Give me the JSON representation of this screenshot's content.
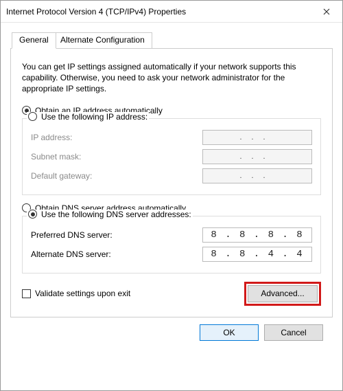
{
  "window": {
    "title": "Internet Protocol Version 4 (TCP/IPv4) Properties"
  },
  "tabs": {
    "general": "General",
    "alt": "Alternate Configuration"
  },
  "intro": "You can get IP settings assigned automatically if your network supports this capability. Otherwise, you need to ask your network administrator for the appropriate IP settings.",
  "ip": {
    "auto": "Obtain an IP address automatically",
    "manual": "Use the following IP address:",
    "addr_label": "IP address:",
    "mask_label": "Subnet mask:",
    "gw_label": "Default gateway:",
    "addr_value": "",
    "mask_value": "",
    "gw_value": ""
  },
  "dns": {
    "auto": "Obtain DNS server address automatically",
    "manual": "Use the following DNS server addresses:",
    "pref_label": "Preferred DNS server:",
    "alt_label": "Alternate DNS server:",
    "pref_value": "8 . 8 . 8 . 8",
    "alt_value": "8 . 8 . 4 . 4"
  },
  "validate": "Validate settings upon exit",
  "buttons": {
    "advanced": "Advanced...",
    "ok": "OK",
    "cancel": "Cancel"
  }
}
